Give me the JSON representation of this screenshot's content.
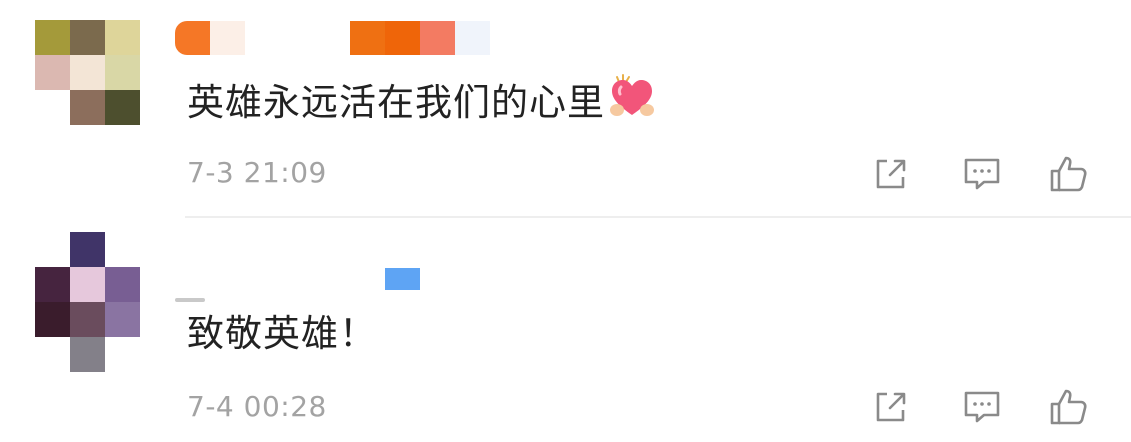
{
  "comments": [
    {
      "text": "英雄永远活在我们的心里",
      "timestamp": "7-3 21:09",
      "emoji_icon": "heart-hands-icon",
      "actions": [
        "share-icon",
        "reply-icon",
        "like-icon"
      ]
    },
    {
      "text": "致敬英雄！",
      "timestamp": "7-4 00:28",
      "actions": [
        "share-icon",
        "reply-icon",
        "like-icon"
      ]
    }
  ],
  "colors": {
    "text": "#222222",
    "timestamp": "#a3a3a3",
    "icon": "#8a8a8a",
    "divider": "#eeeeee"
  }
}
